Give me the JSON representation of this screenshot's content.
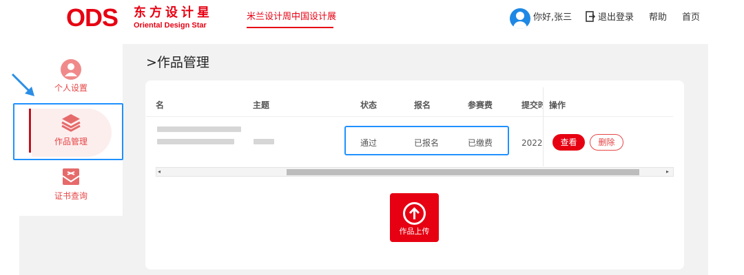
{
  "header": {
    "logo_mark": "ODS",
    "logo_cn": "东方设计星",
    "logo_en": "Oriental Design Star",
    "event_tab": "米兰设计周中国设计展",
    "greeting": "你好,张三",
    "logout": "退出登录",
    "help": "帮助",
    "home": "首页"
  },
  "sidebar": {
    "items": [
      {
        "label": "个人设置",
        "icon": "user-icon"
      },
      {
        "label": "作品管理",
        "icon": "layers-icon",
        "active": true
      },
      {
        "label": "证书查询",
        "icon": "certificate-icon"
      }
    ]
  },
  "main": {
    "title": ">作品管理",
    "table": {
      "columns": [
        "名",
        "主题",
        "状态",
        "报名",
        "参赛费",
        "提交时",
        "操作"
      ],
      "rows": [
        {
          "status": "通过",
          "registration": "已报名",
          "fee": "已缴费",
          "submitted": "2022-"
        }
      ],
      "view_button": "查看",
      "delete_button": "删除"
    },
    "upload_label": "作品上传"
  },
  "colors": {
    "brand_red": "#e60012",
    "highlight_blue": "#1e90ff",
    "sidebar_text": "#e64545"
  }
}
